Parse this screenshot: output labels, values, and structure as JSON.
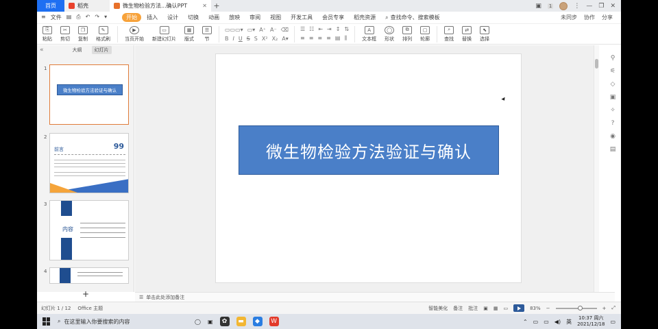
{
  "titlebar": {
    "home_tab": "首页",
    "daoke_tab": "稻壳",
    "doc_tab": "微生物检验方法...确认PPT",
    "add_tab": "+",
    "badge": "1"
  },
  "menubar": {
    "file": "文件",
    "items": [
      "开始",
      "插入",
      "设计",
      "切换",
      "动画",
      "放映",
      "审阅",
      "视图",
      "开发工具",
      "会员专享",
      "稻壳资源"
    ],
    "search": "查找命令、搜索模板",
    "right": [
      "未同步",
      "协作",
      "分享"
    ]
  },
  "ribbon": {
    "paste": "粘贴",
    "cut": "剪切",
    "copy": "复制",
    "format_painter": "格式刷",
    "play_from_current": "当页开始",
    "new_slide": "新建幻灯片",
    "layout": "版式",
    "section": "节",
    "textbox": "文本框",
    "shape": "形状",
    "arrange": "排列",
    "outline": "轮廓",
    "find": "查找",
    "replace": "替换",
    "select": "选择"
  },
  "leftpanel": {
    "tab_outline": "大纲",
    "tab_slides": "幻灯片",
    "add": "+",
    "thumbs": [
      {
        "num": "1",
        "title": "微生物检验方法验证与确认"
      },
      {
        "num": "2",
        "title": "前言",
        "quote": "99"
      },
      {
        "num": "3",
        "title": "内容"
      },
      {
        "num": "4"
      }
    ]
  },
  "slide": {
    "title": "微生物检验方法验证与确认"
  },
  "notes": {
    "placeholder": "单击此处添加备注"
  },
  "statusbar": {
    "slide_count": "幻灯片 1 / 12",
    "theme": "Office 主题",
    "smart": "智能美化",
    "notes_btn": "备注",
    "comment_btn": "批注",
    "zoom": "83%"
  },
  "taskbar": {
    "search_placeholder": "在这里输入你要搜索的内容",
    "time": "10:37",
    "weekday": "周六",
    "date": "2021/12/18",
    "lang": "英"
  },
  "colors": {
    "accent_blue": "#4a7fc8",
    "active_menu": "#f7a23a",
    "home_tab": "#1e6ff2"
  }
}
